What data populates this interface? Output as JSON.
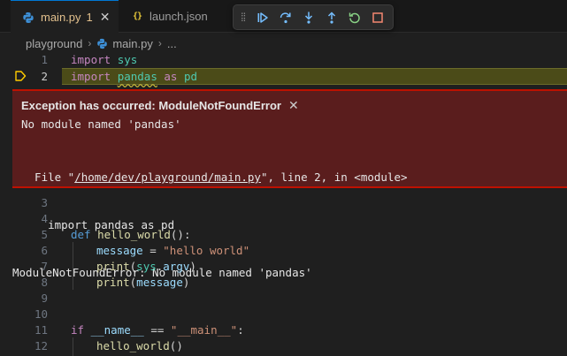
{
  "tabs": [
    {
      "label": "main.py",
      "badge": "1",
      "icon": "python-icon",
      "active": true
    },
    {
      "label": "launch.json",
      "icon": "json-icon",
      "active": false
    }
  ],
  "breadcrumb": {
    "folder": "playground",
    "file": "main.py",
    "more": "..."
  },
  "debug_toolbar": [
    "continue",
    "step-over",
    "step-into",
    "step-out",
    "restart",
    "stop"
  ],
  "exception": {
    "title": "Exception has occurred: ModuleNotFoundError",
    "message": "No module named 'pandas'",
    "tb_prefix": "  File \"",
    "tb_path": "/home/dev/playground/main.py",
    "tb_suffix": "\", line 2, in <module>",
    "tb_code": "    import pandas as pd",
    "tb_error": "ModuleNotFoundError: No module named 'pandas'"
  },
  "line_numbers": [
    "1",
    "2",
    "3",
    "4",
    "5",
    "6",
    "7",
    "8",
    "9",
    "10",
    "11",
    "12"
  ],
  "code": {
    "l1_kw": "import",
    "l1_mod": "sys",
    "l2_kw": "import",
    "l2_mod": "pandas",
    "l2_as": "as",
    "l2_alias": "pd",
    "l5_def": "def",
    "l5_fn": "hello_world",
    "l5_rest": "():",
    "l6_var": "message",
    "l6_eq": " = ",
    "l6_str": "\"hello world\"",
    "l7_fn": "print",
    "l7_open": "(",
    "l7_mod": "sys",
    "l7_dot": ".",
    "l7_attr": "argv",
    "l7_close": ")",
    "l8_fn": "print",
    "l8_open": "(",
    "l8_var": "message",
    "l8_close": ")",
    "l11_if": "if",
    "l11_name": "__name__",
    "l11_eq": " == ",
    "l11_str": "\"__main__\"",
    "l11_colon": ":",
    "l12_fn": "hello_world",
    "l12_call": "()"
  },
  "colors": {
    "accent": "#0078d4",
    "exception_bg": "#5a1d1d",
    "exception_border": "#be1100",
    "current_line": "#4b4b18"
  }
}
